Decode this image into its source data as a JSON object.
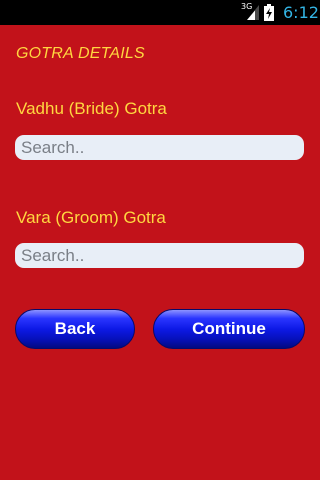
{
  "status_bar": {
    "network": "3G",
    "time": "6:12",
    "accent_color": "#33b5e5"
  },
  "screen": {
    "title": "GOTRA DETAILS",
    "background_color": "#c2121a",
    "label_color": "#ffd740"
  },
  "bride": {
    "label": "Vadhu (Bride) Gotra",
    "value": "",
    "placeholder": "Search.."
  },
  "groom": {
    "label": "Vara (Groom) Gotra",
    "value": "",
    "placeholder": "Search.."
  },
  "buttons": {
    "back_label": "Back",
    "continue_label": "Continue"
  }
}
